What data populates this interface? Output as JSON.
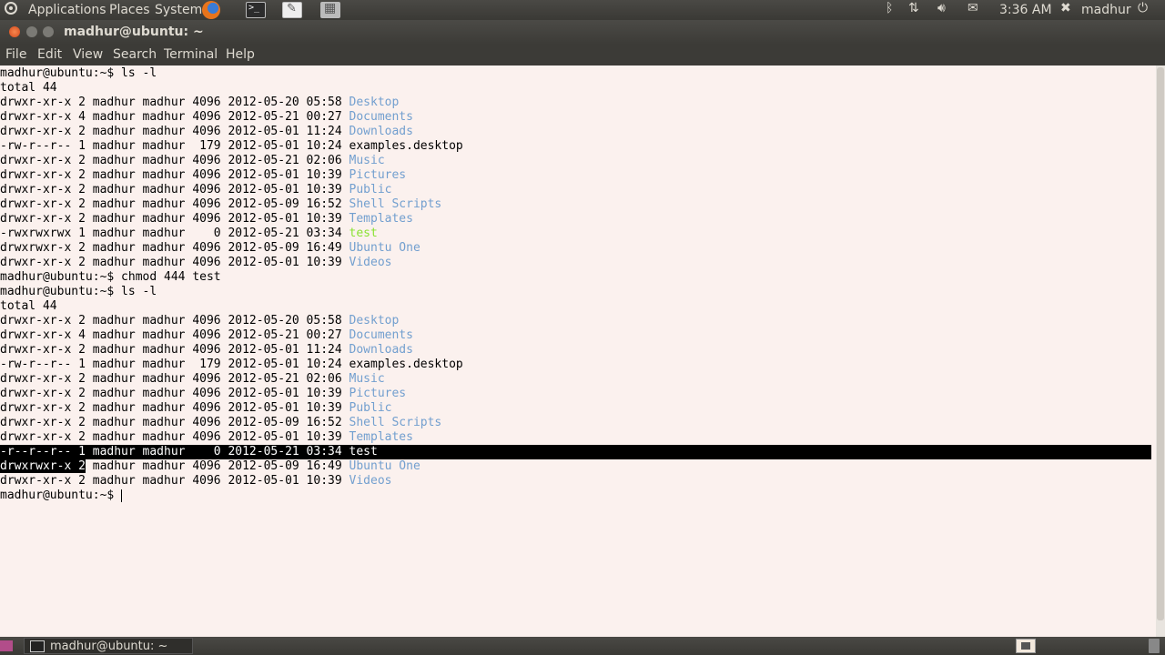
{
  "top_panel": {
    "menus": [
      "Applications",
      "Places",
      "System"
    ],
    "clock": "3:36 AM",
    "user": "madhur"
  },
  "window": {
    "title": "madhur@ubuntu: ~",
    "menus": [
      "File",
      "Edit",
      "View",
      "Search",
      "Terminal",
      "Help"
    ]
  },
  "terminal": {
    "lines": [
      {
        "pre": "madhur@ubuntu:~$ ls -l",
        "name": "",
        "kind": "text"
      },
      {
        "pre": "total 44",
        "name": "",
        "kind": "text"
      },
      {
        "pre": "drwxr-xr-x 2 madhur madhur 4096 2012-05-20 05:58 ",
        "name": "Desktop",
        "kind": "dir"
      },
      {
        "pre": "drwxr-xr-x 4 madhur madhur 4096 2012-05-21 00:27 ",
        "name": "Documents",
        "kind": "dir"
      },
      {
        "pre": "drwxr-xr-x 2 madhur madhur 4096 2012-05-01 11:24 ",
        "name": "Downloads",
        "kind": "dir"
      },
      {
        "pre": "-rw-r--r-- 1 madhur madhur  179 2012-05-01 10:24 ",
        "name": "examples.desktop",
        "kind": "file"
      },
      {
        "pre": "drwxr-xr-x 2 madhur madhur 4096 2012-05-21 02:06 ",
        "name": "Music",
        "kind": "dir"
      },
      {
        "pre": "drwxr-xr-x 2 madhur madhur 4096 2012-05-01 10:39 ",
        "name": "Pictures",
        "kind": "dir"
      },
      {
        "pre": "drwxr-xr-x 2 madhur madhur 4096 2012-05-01 10:39 ",
        "name": "Public",
        "kind": "dir"
      },
      {
        "pre": "drwxr-xr-x 2 madhur madhur 4096 2012-05-09 16:52 ",
        "name": "Shell Scripts",
        "kind": "dir"
      },
      {
        "pre": "drwxr-xr-x 2 madhur madhur 4096 2012-05-01 10:39 ",
        "name": "Templates",
        "kind": "dir"
      },
      {
        "pre": "-rwxrwxrwx 1 madhur madhur    0 2012-05-21 03:34 ",
        "name": "test",
        "kind": "exe"
      },
      {
        "pre": "drwxrwxr-x 2 madhur madhur 4096 2012-05-09 16:49 ",
        "name": "Ubuntu One",
        "kind": "dir"
      },
      {
        "pre": "drwxr-xr-x 2 madhur madhur 4096 2012-05-01 10:39 ",
        "name": "Videos",
        "kind": "dir"
      },
      {
        "pre": "madhur@ubuntu:~$ chmod 444 test",
        "name": "",
        "kind": "text"
      },
      {
        "pre": "madhur@ubuntu:~$ ls -l",
        "name": "",
        "kind": "text"
      },
      {
        "pre": "total 44",
        "name": "",
        "kind": "text"
      },
      {
        "pre": "drwxr-xr-x 2 madhur madhur 4096 2012-05-20 05:58 ",
        "name": "Desktop",
        "kind": "dir"
      },
      {
        "pre": "drwxr-xr-x 4 madhur madhur 4096 2012-05-21 00:27 ",
        "name": "Documents",
        "kind": "dir"
      },
      {
        "pre": "drwxr-xr-x 2 madhur madhur 4096 2012-05-01 11:24 ",
        "name": "Downloads",
        "kind": "dir"
      },
      {
        "pre": "-rw-r--r-- 1 madhur madhur  179 2012-05-01 10:24 ",
        "name": "examples.desktop",
        "kind": "file"
      },
      {
        "pre": "drwxr-xr-x 2 madhur madhur 4096 2012-05-21 02:06 ",
        "name": "Music",
        "kind": "dir"
      },
      {
        "pre": "drwxr-xr-x 2 madhur madhur 4096 2012-05-01 10:39 ",
        "name": "Pictures",
        "kind": "dir"
      },
      {
        "pre": "drwxr-xr-x 2 madhur madhur 4096 2012-05-01 10:39 ",
        "name": "Public",
        "kind": "dir"
      },
      {
        "pre": "drwxr-xr-x 2 madhur madhur 4096 2012-05-09 16:52 ",
        "name": "Shell Scripts",
        "kind": "dir"
      },
      {
        "pre": "drwxr-xr-x 2 madhur madhur 4096 2012-05-01 10:39 ",
        "name": "Templates",
        "kind": "dir"
      },
      {
        "pre": "-r--r--r-- 1 madhur madhur    0 2012-05-21 03:34 ",
        "name": "test",
        "kind": "selected"
      },
      {
        "pre": "drwxrwxr-x 2 madhur madhur 4096 2012-05-09 16:49 ",
        "name": "Ubuntu One",
        "kind": "dir",
        "selected_chars": 12
      },
      {
        "pre": "drwxr-xr-x 2 madhur madhur 4096 2012-05-01 10:39 ",
        "name": "Videos",
        "kind": "dir"
      },
      {
        "pre": "madhur@ubuntu:~$ ",
        "name": "",
        "kind": "prompt"
      }
    ]
  },
  "bottom_panel": {
    "task": "madhur@ubuntu: ~"
  },
  "colors": {
    "directory": "#729fcf",
    "executable": "#8ae234",
    "terminal_bg": "#fbf1ee"
  }
}
